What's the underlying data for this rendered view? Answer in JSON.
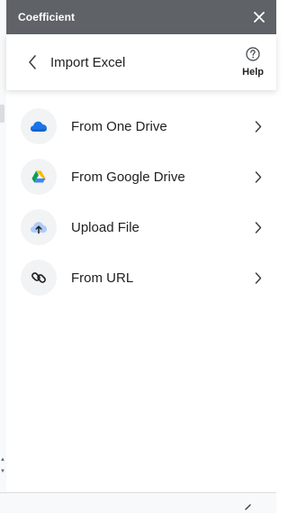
{
  "panel": {
    "app_title": "Coefficient",
    "header_title": "Import Excel",
    "help_label": "Help"
  },
  "sources": [
    {
      "label": "From One Drive",
      "icon": "onedrive-cloud-icon"
    },
    {
      "label": "From Google Drive",
      "icon": "google-drive-icon"
    },
    {
      "label": "Upload File",
      "icon": "upload-cloud-icon"
    },
    {
      "label": "From URL",
      "icon": "link-icon"
    }
  ],
  "colors": {
    "titlebar_bg": "#5f6368",
    "icon_circle_bg": "#f1f3f4",
    "onedrive_blue": "#1a73e8",
    "upload_cloud_blue": "#aecbfa"
  }
}
